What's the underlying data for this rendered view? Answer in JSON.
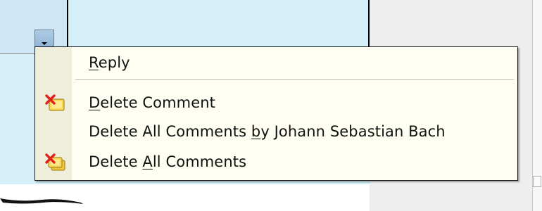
{
  "comment_button": {
    "icon": "chevron-down-icon"
  },
  "context_menu": {
    "items": [
      {
        "before": "",
        "mnemonic": "R",
        "after": "eply",
        "icon": null
      },
      {
        "before": "",
        "mnemonic": "D",
        "after": "elete Comment",
        "icon": "delete-comment-icon"
      },
      {
        "before": "Delete All Comments ",
        "mnemonic": "b",
        "after": "y Johann Sebastian Bach",
        "icon": null
      },
      {
        "before": "Delete ",
        "mnemonic": "A",
        "after": "ll Comments",
        "icon": "delete-all-comments-icon"
      }
    ]
  },
  "colors": {
    "menu_background": "#fffef2",
    "icon_column": "#efeedc",
    "sidebar_background": "#d5f0f8",
    "delete_icon_red": "#e0201a",
    "note_icon_yellow": "#f7d85a"
  }
}
